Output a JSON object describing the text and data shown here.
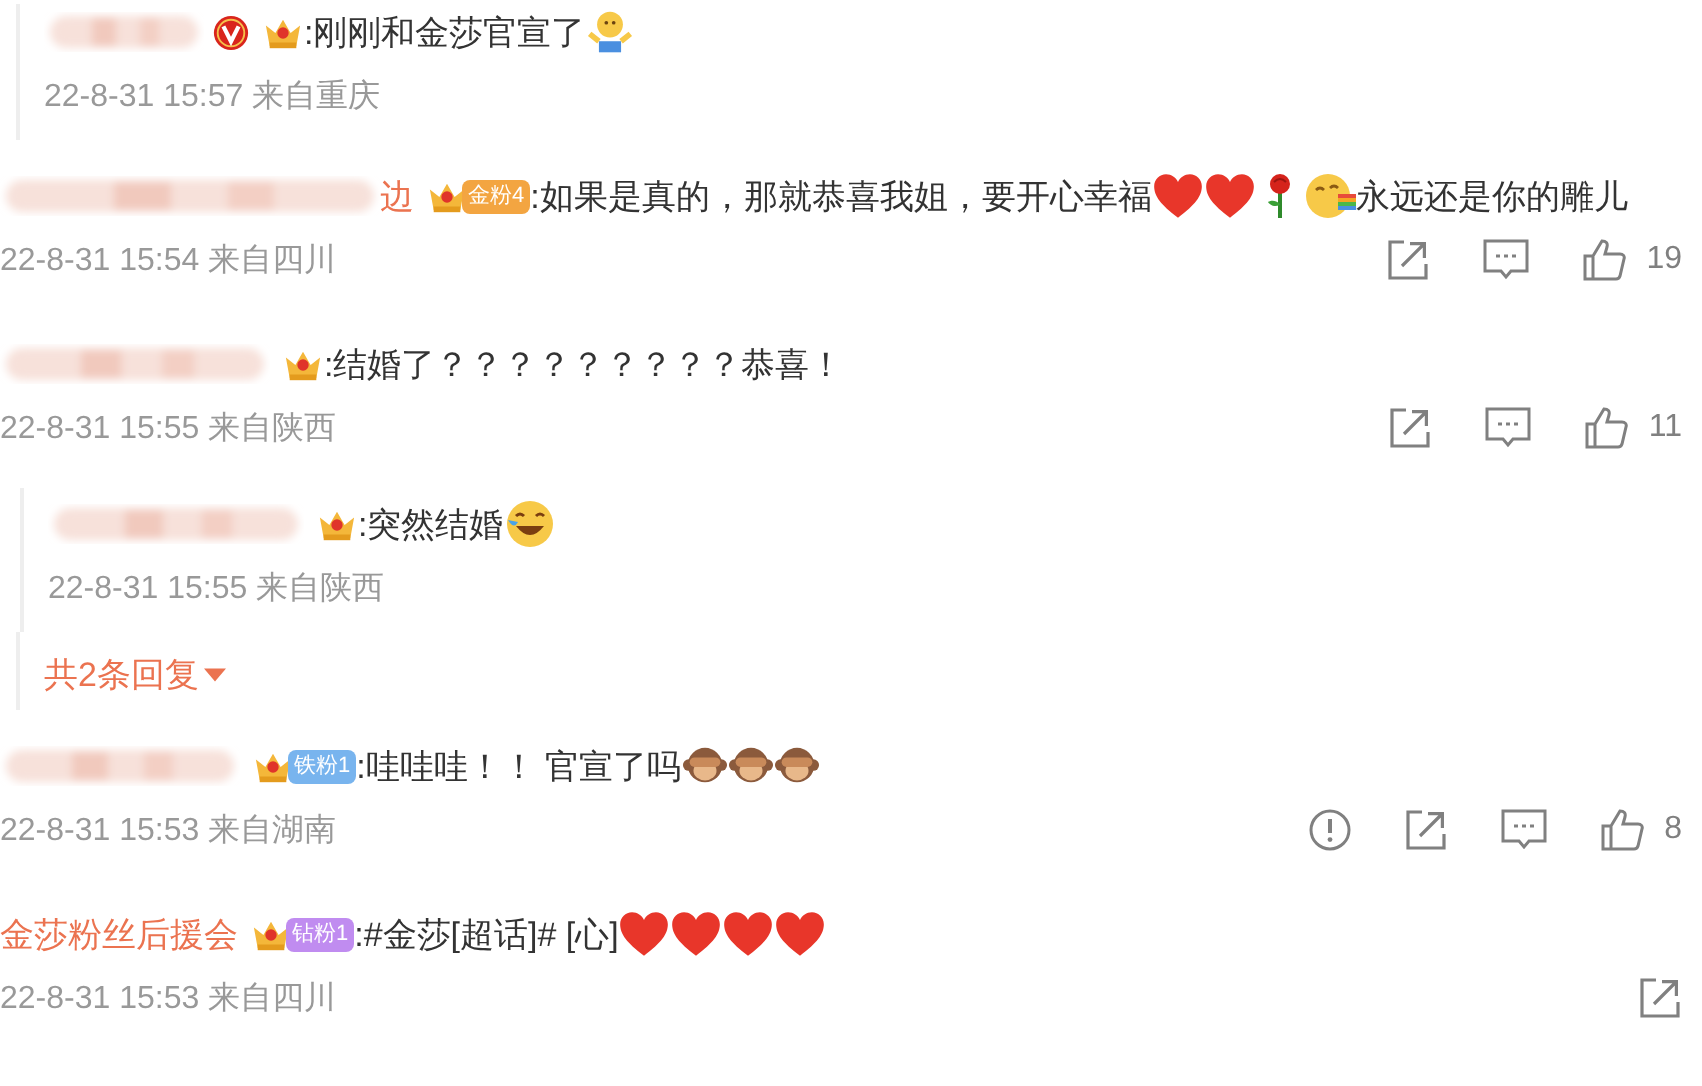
{
  "items": [
    {
      "kind": "reply",
      "verified": true,
      "content": [
        {
          "kind": "text",
          "text": ":刚刚和金莎官宣了"
        },
        {
          "kind": "shrug-face"
        }
      ],
      "time": "22-8-31 15:57 来自重庆"
    },
    {
      "kind": "comment",
      "name_tail": "边",
      "verified": false,
      "badge": {
        "kind": "gold",
        "label": "金粉4"
      },
      "content": [
        {
          "kind": "text",
          "text": ":如果是真的，那就恭喜我姐，要开心幸福"
        },
        {
          "kind": "heart"
        },
        {
          "kind": "heart"
        },
        {
          "kind": "rose"
        },
        {
          "kind": "rainbow-face"
        },
        {
          "kind": "text",
          "text": "永远还是你的雕儿"
        }
      ],
      "time": "22-8-31 15:54 来自四川",
      "actions": [
        {
          "kind": "share"
        },
        {
          "kind": "comment"
        },
        {
          "kind": "like",
          "count": "19"
        }
      ]
    },
    {
      "kind": "comment",
      "verified": false,
      "content": [
        {
          "kind": "text",
          "text": ":结婚了？？？？？？？？？恭喜！"
        }
      ],
      "time": "22-8-31 15:55 来自陕西",
      "actions": [
        {
          "kind": "share"
        },
        {
          "kind": "comment"
        },
        {
          "kind": "like",
          "count": "11"
        }
      ]
    },
    {
      "kind": "reply",
      "verified": false,
      "content": [
        {
          "kind": "text",
          "text": ":突然结婚"
        },
        {
          "kind": "laugh-face"
        }
      ],
      "time": "22-8-31 15:55 来自陕西"
    },
    {
      "kind": "more",
      "label": "共2条回复"
    },
    {
      "kind": "comment",
      "verified": false,
      "badge": {
        "kind": "iron",
        "label": "铁粉1"
      },
      "content": [
        {
          "kind": "text",
          "text": ":哇哇哇！！ 官宣了吗"
        },
        {
          "kind": "monkey"
        },
        {
          "kind": "monkey"
        },
        {
          "kind": "monkey"
        }
      ],
      "time": "22-8-31 15:53 来自湖南",
      "actions": [
        {
          "kind": "report"
        },
        {
          "kind": "share"
        },
        {
          "kind": "comment"
        },
        {
          "kind": "like",
          "count": "8"
        }
      ]
    },
    {
      "kind": "comment",
      "name": "金莎粉丝后援会",
      "verified": false,
      "badge": {
        "kind": "diamond",
        "label": "钻粉1"
      },
      "content": [
        {
          "kind": "text",
          "text": ":#金莎[超话]# [心]"
        },
        {
          "kind": "heart"
        },
        {
          "kind": "heart"
        },
        {
          "kind": "heart"
        },
        {
          "kind": "heart"
        }
      ],
      "time": "22-8-31 15:53 来自四川",
      "actions": [
        {
          "kind": "share"
        }
      ]
    }
  ]
}
